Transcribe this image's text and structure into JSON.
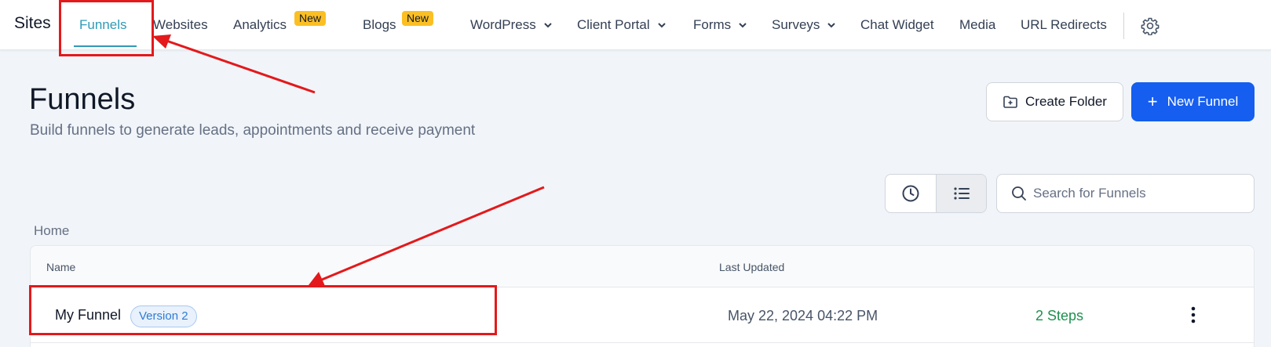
{
  "nav": {
    "brand": "Sites",
    "items": [
      {
        "label": "Funnels",
        "active": true
      },
      {
        "label": "Websites"
      },
      {
        "label": "Analytics",
        "badge": "New"
      },
      {
        "label": "Blogs",
        "badge": "New"
      },
      {
        "label": "WordPress",
        "dropdown": true
      },
      {
        "label": "Client Portal",
        "dropdown": true
      },
      {
        "label": "Forms",
        "dropdown": true
      },
      {
        "label": "Surveys",
        "dropdown": true
      },
      {
        "label": "Chat Widget"
      },
      {
        "label": "Media"
      },
      {
        "label": "URL Redirects"
      }
    ],
    "settings_icon": "gear-icon"
  },
  "header": {
    "title": "Funnels",
    "subtitle": "Build funnels to generate leads, appointments and receive payment",
    "create_folder_label": "Create Folder",
    "new_funnel_label": "New Funnel"
  },
  "toolbar": {
    "views": [
      "clock-icon",
      "list-icon"
    ],
    "active_view": "list",
    "search_placeholder": "Search for Funnels"
  },
  "breadcrumb": "Home",
  "table": {
    "columns": [
      "Name",
      "Last Updated"
    ],
    "rows": [
      {
        "name": "My Funnel",
        "badge": "Version 2",
        "last_updated": "May 22, 2024 04:22 PM",
        "steps": "2 Steps"
      }
    ]
  },
  "colors": {
    "accent": "#2f9bb7",
    "primary_button": "#155eef",
    "badge_new": "#fbbf24",
    "steps_text": "#1f8f4e",
    "annotation": "#e3191c"
  }
}
